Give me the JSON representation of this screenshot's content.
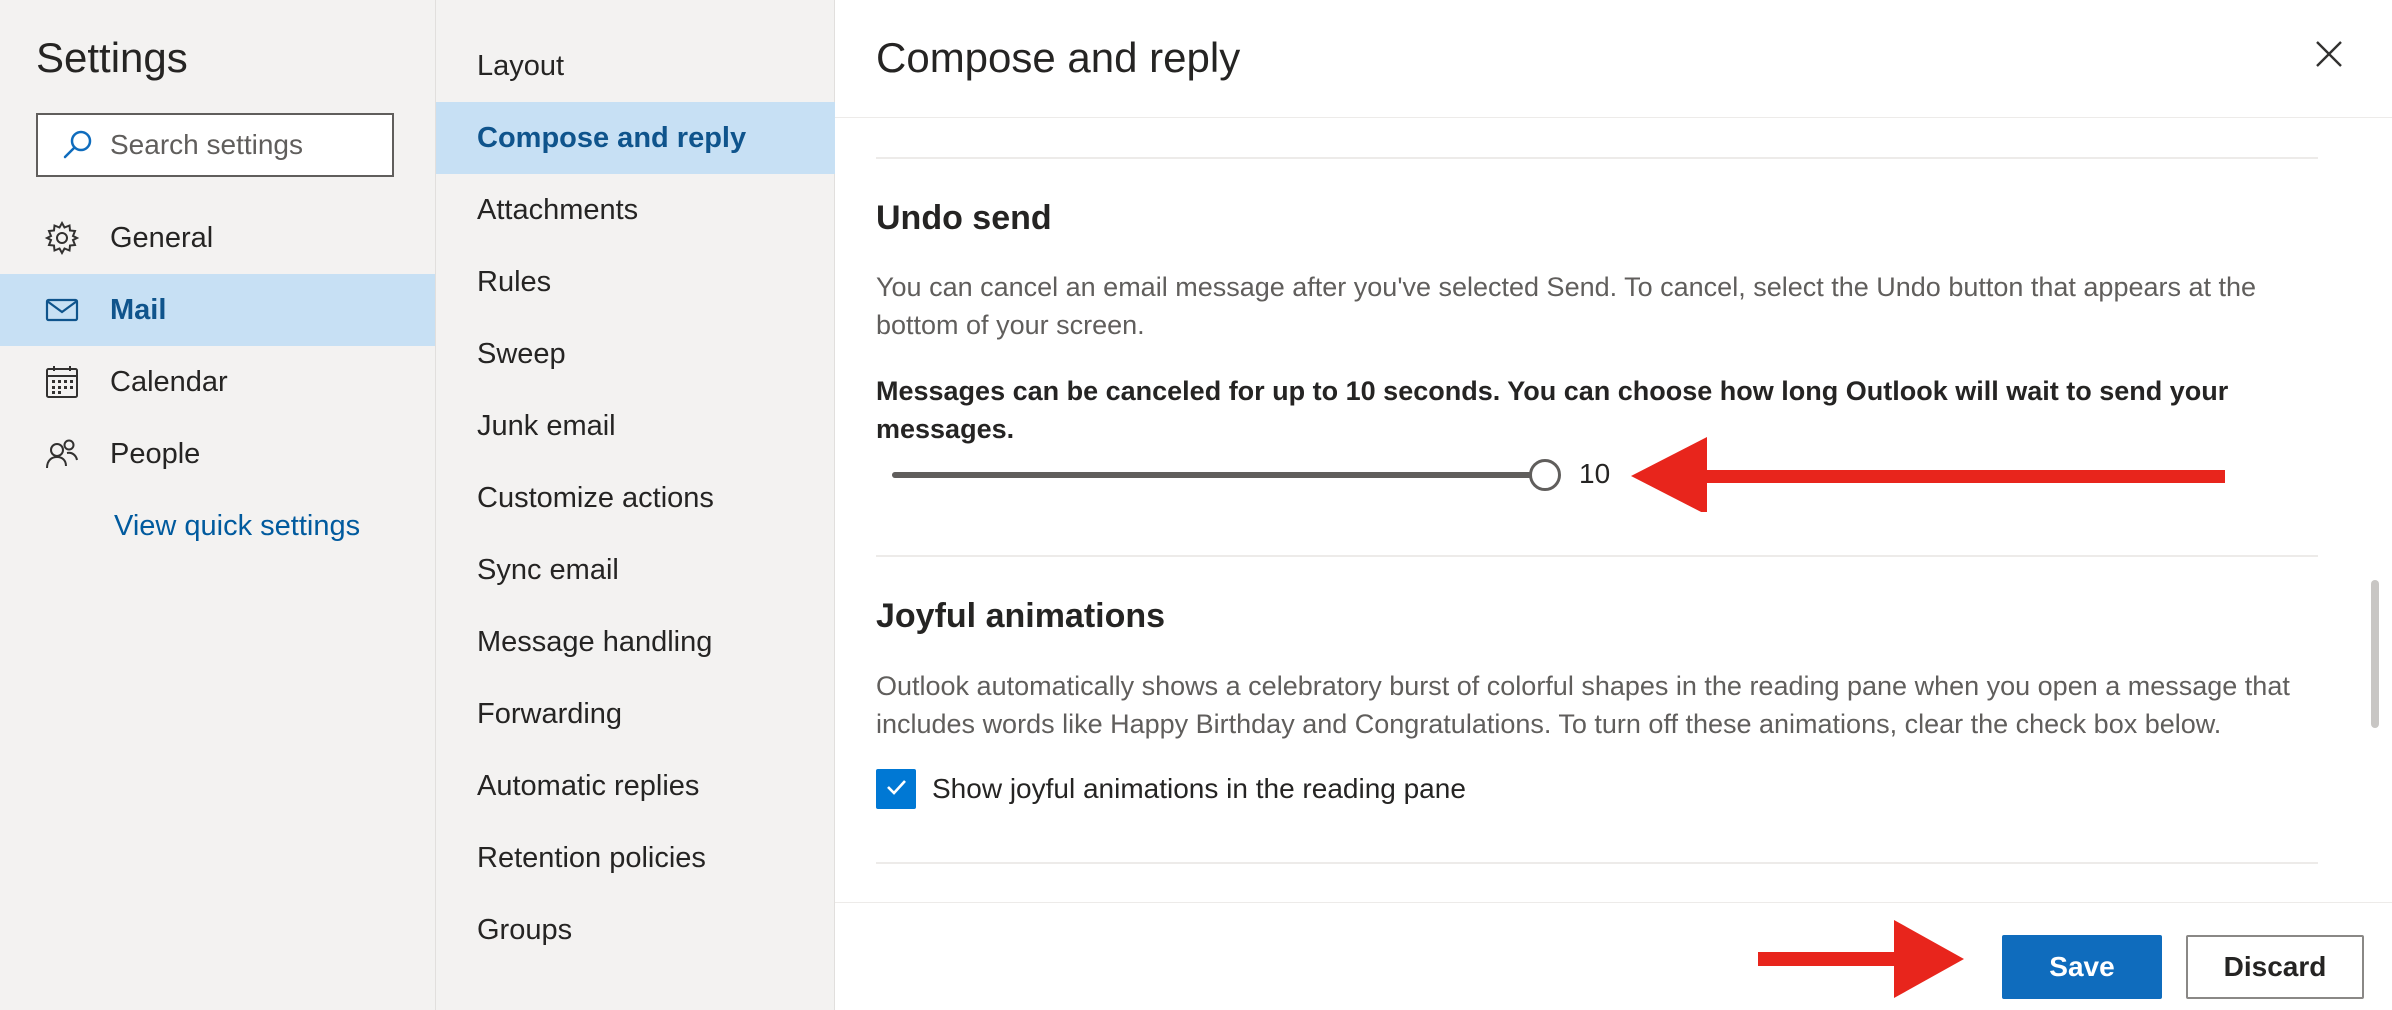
{
  "colors": {
    "accent": "#0f6cbd",
    "selected_bg": "#c7e0f4",
    "selected_text": "#0f548c",
    "pane_bg": "#f3f2f1",
    "link": "#005a9e",
    "annotation_arrow": "#e8251c"
  },
  "sidebar": {
    "title": "Settings",
    "search": {
      "placeholder": "Search settings",
      "icon": "search-icon"
    },
    "items": [
      {
        "label": "General",
        "icon": "gear-icon",
        "selected": false
      },
      {
        "label": "Mail",
        "icon": "mail-icon",
        "selected": true
      },
      {
        "label": "Calendar",
        "icon": "calendar-icon",
        "selected": false
      },
      {
        "label": "People",
        "icon": "people-icon",
        "selected": false
      }
    ],
    "quick_settings_link": "View quick settings"
  },
  "submenu": {
    "items": [
      {
        "label": "Layout",
        "selected": false
      },
      {
        "label": "Compose and reply",
        "selected": true
      },
      {
        "label": "Attachments",
        "selected": false
      },
      {
        "label": "Rules",
        "selected": false
      },
      {
        "label": "Sweep",
        "selected": false
      },
      {
        "label": "Junk email",
        "selected": false
      },
      {
        "label": "Customize actions",
        "selected": false
      },
      {
        "label": "Sync email",
        "selected": false
      },
      {
        "label": "Message handling",
        "selected": false
      },
      {
        "label": "Forwarding",
        "selected": false
      },
      {
        "label": "Automatic replies",
        "selected": false
      },
      {
        "label": "Retention policies",
        "selected": false
      },
      {
        "label": "Groups",
        "selected": false
      }
    ]
  },
  "content": {
    "title": "Compose and reply",
    "close_icon": "close-icon",
    "undo_send": {
      "title": "Undo send",
      "description": "You can cancel an email message after you've selected Send. To cancel, select the Undo button that appears at the bottom of your screen.",
      "bold_text": "Messages can be canceled for up to 10 seconds. You can choose how long Outlook will wait to send your messages.",
      "slider_value": "10",
      "slider_fraction": 1.0
    },
    "joyful_animations": {
      "title": "Joyful animations",
      "description": "Outlook automatically shows a celebratory burst of colorful shapes in the reading pane when you open a message that includes words like Happy Birthday and Congratulations. To turn off these animations, clear the check box below.",
      "checkbox_label": "Show joyful animations in the reading pane",
      "checked": true
    }
  },
  "footer": {
    "save_label": "Save",
    "discard_label": "Discard"
  }
}
